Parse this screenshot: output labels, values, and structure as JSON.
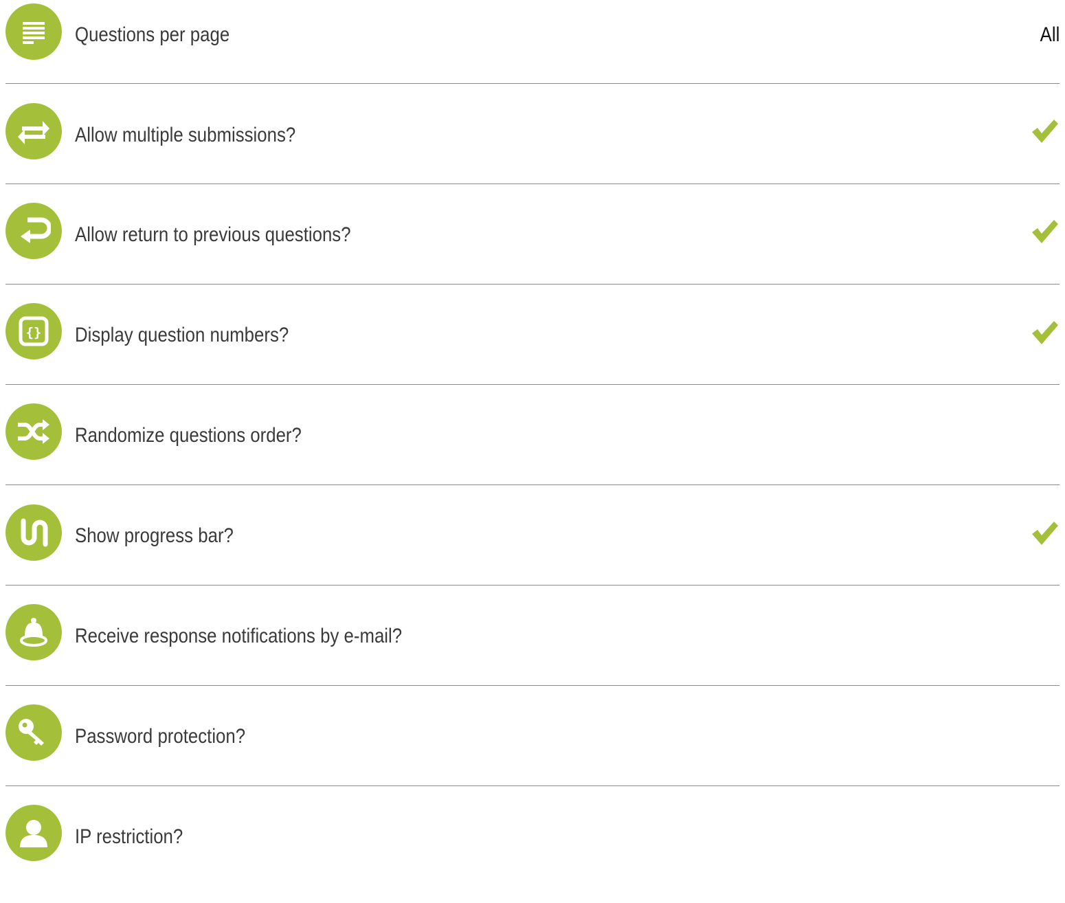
{
  "accent_color": "#a4c03a",
  "settings": [
    {
      "label": "Questions per page",
      "icon": "lines-icon",
      "value": "All",
      "checked": null
    },
    {
      "label": "Allow multiple submissions?",
      "icon": "repeat-icon",
      "value": null,
      "checked": true
    },
    {
      "label": "Allow return to previous questions?",
      "icon": "return-icon",
      "value": null,
      "checked": true
    },
    {
      "label": "Display question numbers?",
      "icon": "braces-icon",
      "value": null,
      "checked": true
    },
    {
      "label": "Randomize questions order?",
      "icon": "shuffle-icon",
      "value": null,
      "checked": false
    },
    {
      "label": "Show progress bar?",
      "icon": "progress-icon",
      "value": null,
      "checked": true
    },
    {
      "label": "Receive response notifications by e-mail?",
      "icon": "bell-icon",
      "value": null,
      "checked": false
    },
    {
      "label": "Password protection?",
      "icon": "key-icon",
      "value": null,
      "checked": false
    },
    {
      "label": "IP restriction?",
      "icon": "user-icon",
      "value": null,
      "checked": false
    }
  ]
}
